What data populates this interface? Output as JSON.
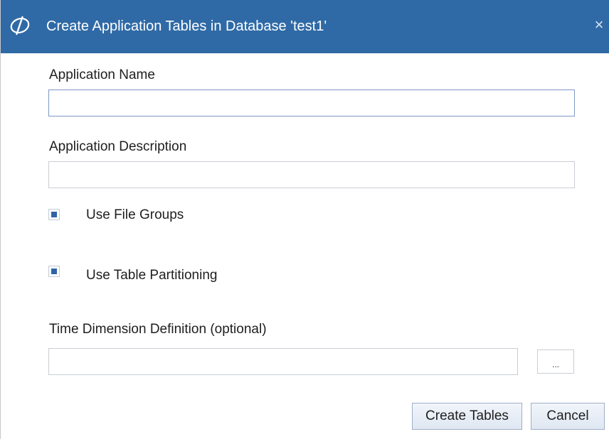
{
  "window": {
    "title": "Create Application Tables in Database 'test1'",
    "title_icon": "app-logo-icon",
    "close_glyph": "×",
    "titlebar_color": "#2f6aa6"
  },
  "form": {
    "app_name_label": "Application Name",
    "app_name_value": "",
    "app_description_label": "Application Description",
    "app_description_value": "",
    "use_file_groups_label": "Use File Groups",
    "use_file_groups_checked": true,
    "use_table_partitioning_label": "Use Table Partitioning",
    "use_table_partitioning_checked": true,
    "time_dimension_label": "Time Dimension Definition (optional)",
    "time_dimension_value": "",
    "browse_label": "..."
  },
  "buttons": {
    "create_tables": "Create Tables",
    "cancel": "Cancel"
  }
}
